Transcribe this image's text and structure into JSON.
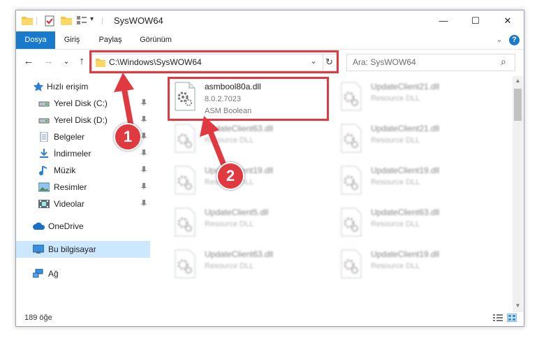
{
  "window": {
    "title": "SysWOW64",
    "minimize": "—",
    "maximize": "☐",
    "close": "✕"
  },
  "ribbon": {
    "tabs": [
      "Dosya",
      "Giriş",
      "Paylaş",
      "Görünüm"
    ],
    "expand_glyph": "⌄",
    "help_glyph": "?"
  },
  "nav": {
    "back": "←",
    "forward": "→",
    "recent": "⌄",
    "up": "↑",
    "address": "C:\\Windows\\SysWOW64",
    "address_dropdown": "⌄",
    "refresh": "↻",
    "search_placeholder": "Ara: SysWOW64",
    "search_glyph": "⌕"
  },
  "sidebar": {
    "quick_access": "Hızlı erişim",
    "items": [
      {
        "label": "Yerel Disk (C:)",
        "icon": "drive-icon"
      },
      {
        "label": "Yerel Disk (D:)",
        "icon": "drive-icon"
      },
      {
        "label": "Belgeler",
        "icon": "documents-icon"
      },
      {
        "label": "İndirmeler",
        "icon": "downloads-icon"
      },
      {
        "label": "Müzik",
        "icon": "music-icon"
      },
      {
        "label": "Resimler",
        "icon": "pictures-icon"
      },
      {
        "label": "Videolar",
        "icon": "videos-icon"
      }
    ],
    "pin_glyph": "📌",
    "onedrive": "OneDrive",
    "this_pc": "Bu bilgisayar",
    "network": "Ağ"
  },
  "files": [
    {
      "name": "asmbool80a.dll",
      "line2": "8.0.2.7023",
      "line3": "ASM Boolean"
    },
    {
      "name": "UpdateClient21.dll",
      "line2": "Resource DLL"
    },
    {
      "name": "UpdateClient63.dll",
      "line2": "Resource DLL"
    },
    {
      "name": "UpdateClient21.dll",
      "line2": "Resource DLL"
    },
    {
      "name": "UpdateClient19.dll",
      "line2": "Resource DLL"
    },
    {
      "name": "UpdateClient19.dll",
      "line2": "Resource DLL"
    },
    {
      "name": "UpdateClient5.dll",
      "line2": "Resource DLL"
    },
    {
      "name": "UpdateClient63.dll",
      "line2": "Resource DLL"
    },
    {
      "name": "UpdateClient63.dll",
      "line2": "Resource DLL"
    },
    {
      "name": "UpdateClient19.dll",
      "line2": "Resource DLL"
    }
  ],
  "status": {
    "count": "189 öğe"
  },
  "callouts": {
    "one": "1",
    "two": "2"
  },
  "colors": {
    "accent": "#1979ca",
    "highlight": "#e0393f",
    "selection": "#cce8ff"
  }
}
